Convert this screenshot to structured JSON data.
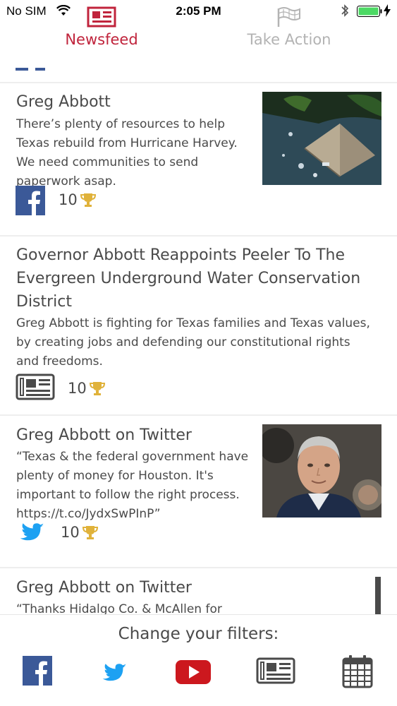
{
  "status_bar": {
    "carrier": "No SIM",
    "time": "2:05 PM"
  },
  "tabs": [
    {
      "label": "Newsfeed",
      "icon": "newspaper-icon",
      "active": true,
      "color": "#c0243c"
    },
    {
      "label": "Take Action",
      "icon": "flags-icon",
      "active": false,
      "color": "#b3b3b3"
    }
  ],
  "feed": [
    {
      "title": "Greg Abbott",
      "text_lines": [
        "There’s plenty of resources to help",
        "Texas rebuild from Hurricane Harvey.",
        "We need communities to send",
        "paperwork asap."
      ],
      "source": "facebook-icon",
      "score": "10",
      "has_image": true
    },
    {
      "title_lines": [
        "Governor Abbott Reappoints Peeler To The",
        "Evergreen Underground Water Conservation",
        "District"
      ],
      "text_lines": [
        "Greg Abbott is fighting for Texas families and Texas values,",
        "by creating jobs and defending our constitutional rights",
        "and freedoms."
      ],
      "source": "newspaper-icon",
      "score": "10",
      "has_image": false
    },
    {
      "title": "Greg Abbott on Twitter",
      "text_lines": [
        "“Texas & the federal government have",
        "plenty of money for Houston. It's",
        "important to follow the right process.",
        "https://t.co/JydxSwPInP”"
      ],
      "source": "twitter-icon",
      "score": "10",
      "has_image": true
    },
    {
      "title": "Greg Abbott on Twitter",
      "text_lines": [
        "“Thanks Hidalgo Co. & McAllen for"
      ],
      "source": "twitter-icon",
      "score": "",
      "has_image": false
    }
  ],
  "filters": {
    "title": "Change your filters:",
    "buttons": [
      "facebook-icon",
      "twitter-icon",
      "youtube-icon",
      "newspaper-icon",
      "calendar-icon"
    ]
  },
  "colors": {
    "accent": "#c0243c",
    "facebook": "#3b5998",
    "twitter": "#1da1f2",
    "youtube": "#cc181e",
    "trophy": "#e0b23a",
    "battery": "#4cd964"
  }
}
